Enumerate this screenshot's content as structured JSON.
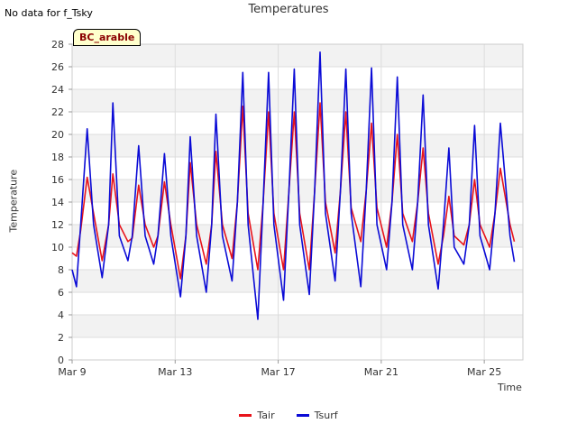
{
  "note": "No data for f_Tsky",
  "badge": "BC_arable",
  "colors": {
    "Tair": "#e8141b",
    "Tsurf": "#0b0bd6",
    "band": "#f2f2f2",
    "grid": "#dddddd"
  },
  "chart_data": {
    "type": "line",
    "title": "Temperatures",
    "xlabel": "Time",
    "ylabel": "Temperature",
    "x_range": [
      "2024-03-09",
      "2024-03-26 12:00"
    ],
    "ylim": [
      0,
      28
    ],
    "yticks": [
      0,
      2,
      4,
      6,
      8,
      10,
      12,
      14,
      16,
      18,
      20,
      22,
      24,
      26,
      28
    ],
    "xticks": [
      {
        "date": "2024-03-09",
        "label": "Mar 9"
      },
      {
        "date": "2024-03-13",
        "label": "Mar 13"
      },
      {
        "date": "2024-03-17",
        "label": "Mar 17"
      },
      {
        "date": "2024-03-21",
        "label": "Mar 21"
      },
      {
        "date": "2024-03-25",
        "label": "Mar 25"
      }
    ],
    "grid": true,
    "legend_position": "bottom-center",
    "series": [
      {
        "name": "Tair",
        "points": [
          [
            "2024-03-09 00:00",
            9.5
          ],
          [
            "2024-03-09 04:00",
            9.2
          ],
          [
            "2024-03-09 08:00",
            11.5
          ],
          [
            "2024-03-09 14:00",
            16.2
          ],
          [
            "2024-03-09 20:00",
            13.0
          ],
          [
            "2024-03-10 04:00",
            8.8
          ],
          [
            "2024-03-10 10:00",
            12.0
          ],
          [
            "2024-03-10 14:00",
            16.5
          ],
          [
            "2024-03-10 20:00",
            12.0
          ],
          [
            "2024-03-11 04:00",
            10.5
          ],
          [
            "2024-03-11 08:00",
            10.8
          ],
          [
            "2024-03-11 14:00",
            15.5
          ],
          [
            "2024-03-11 20:00",
            12.0
          ],
          [
            "2024-03-12 04:00",
            10.0
          ],
          [
            "2024-03-12 08:00",
            11.0
          ],
          [
            "2024-03-12 14:00",
            15.8
          ],
          [
            "2024-03-12 20:00",
            12.0
          ],
          [
            "2024-03-13 05:00",
            7.2
          ],
          [
            "2024-03-13 10:00",
            11.0
          ],
          [
            "2024-03-13 14:00",
            17.5
          ],
          [
            "2024-03-13 20:00",
            12.0
          ],
          [
            "2024-03-14 05:00",
            8.5
          ],
          [
            "2024-03-14 10:00",
            12.0
          ],
          [
            "2024-03-14 14:00",
            18.5
          ],
          [
            "2024-03-14 20:00",
            12.0
          ],
          [
            "2024-03-15 05:00",
            9.0
          ],
          [
            "2024-03-15 10:00",
            14.0
          ],
          [
            "2024-03-15 15:00",
            22.5
          ],
          [
            "2024-03-15 20:00",
            13.0
          ],
          [
            "2024-03-16 05:00",
            8.0
          ],
          [
            "2024-03-16 10:00",
            14.0
          ],
          [
            "2024-03-16 15:00",
            22.0
          ],
          [
            "2024-03-16 20:00",
            13.0
          ],
          [
            "2024-03-17 05:00",
            8.0
          ],
          [
            "2024-03-17 10:00",
            15.0
          ],
          [
            "2024-03-17 15:00",
            22.0
          ],
          [
            "2024-03-17 20:00",
            13.0
          ],
          [
            "2024-03-18 05:00",
            8.0
          ],
          [
            "2024-03-18 10:00",
            15.0
          ],
          [
            "2024-03-18 15:00",
            22.8
          ],
          [
            "2024-03-18 20:00",
            14.0
          ],
          [
            "2024-03-19 05:00",
            9.5
          ],
          [
            "2024-03-19 10:00",
            15.0
          ],
          [
            "2024-03-19 15:00",
            22.0
          ],
          [
            "2024-03-19 20:00",
            13.5
          ],
          [
            "2024-03-20 05:00",
            10.5
          ],
          [
            "2024-03-20 10:00",
            15.0
          ],
          [
            "2024-03-20 15:00",
            21.0
          ],
          [
            "2024-03-20 20:00",
            13.5
          ],
          [
            "2024-03-21 05:00",
            10.0
          ],
          [
            "2024-03-21 10:00",
            14.0
          ],
          [
            "2024-03-21 15:00",
            20.0
          ],
          [
            "2024-03-21 20:00",
            13.0
          ],
          [
            "2024-03-22 05:00",
            10.5
          ],
          [
            "2024-03-22 10:00",
            14.0
          ],
          [
            "2024-03-22 15:00",
            18.8
          ],
          [
            "2024-03-22 20:00",
            13.0
          ],
          [
            "2024-03-23 05:00",
            8.5
          ],
          [
            "2024-03-23 10:00",
            11.0
          ],
          [
            "2024-03-23 15:00",
            14.5
          ],
          [
            "2024-03-23 20:00",
            11.0
          ],
          [
            "2024-03-24 05:00",
            10.2
          ],
          [
            "2024-03-24 10:00",
            12.0
          ],
          [
            "2024-03-24 15:00",
            16.0
          ],
          [
            "2024-03-24 20:00",
            12.0
          ],
          [
            "2024-03-25 05:00",
            10.0
          ],
          [
            "2024-03-25 10:00",
            13.0
          ],
          [
            "2024-03-25 15:00",
            17.0
          ],
          [
            "2024-03-26 00:00",
            12.0
          ],
          [
            "2024-03-26 04:00",
            10.5
          ]
        ]
      },
      {
        "name": "Tsurf",
        "points": [
          [
            "2024-03-09 00:00",
            8.0
          ],
          [
            "2024-03-09 04:00",
            6.5
          ],
          [
            "2024-03-09 08:00",
            12.0
          ],
          [
            "2024-03-09 14:00",
            20.5
          ],
          [
            "2024-03-09 20:00",
            12.0
          ],
          [
            "2024-03-10 04:00",
            7.3
          ],
          [
            "2024-03-10 10:00",
            12.0
          ],
          [
            "2024-03-10 14:00",
            22.8
          ],
          [
            "2024-03-10 20:00",
            11.0
          ],
          [
            "2024-03-11 04:00",
            8.8
          ],
          [
            "2024-03-11 08:00",
            11.0
          ],
          [
            "2024-03-11 14:00",
            19.0
          ],
          [
            "2024-03-11 20:00",
            11.0
          ],
          [
            "2024-03-12 04:00",
            8.5
          ],
          [
            "2024-03-12 08:00",
            11.0
          ],
          [
            "2024-03-12 14:00",
            18.3
          ],
          [
            "2024-03-12 20:00",
            11.0
          ],
          [
            "2024-03-13 05:00",
            5.6
          ],
          [
            "2024-03-13 10:00",
            11.0
          ],
          [
            "2024-03-13 14:00",
            19.8
          ],
          [
            "2024-03-13 20:00",
            11.0
          ],
          [
            "2024-03-14 05:00",
            6.0
          ],
          [
            "2024-03-14 10:00",
            12.0
          ],
          [
            "2024-03-14 14:00",
            21.8
          ],
          [
            "2024-03-14 20:00",
            11.0
          ],
          [
            "2024-03-15 05:00",
            7.0
          ],
          [
            "2024-03-15 10:00",
            14.0
          ],
          [
            "2024-03-15 15:00",
            25.5
          ],
          [
            "2024-03-15 20:00",
            12.0
          ],
          [
            "2024-03-16 05:00",
            3.6
          ],
          [
            "2024-03-16 10:00",
            14.0
          ],
          [
            "2024-03-16 15:00",
            25.5
          ],
          [
            "2024-03-16 20:00",
            12.0
          ],
          [
            "2024-03-17 05:00",
            5.3
          ],
          [
            "2024-03-17 10:00",
            15.0
          ],
          [
            "2024-03-17 15:00",
            25.8
          ],
          [
            "2024-03-17 20:00",
            12.0
          ],
          [
            "2024-03-18 05:00",
            5.8
          ],
          [
            "2024-03-18 10:00",
            15.0
          ],
          [
            "2024-03-18 15:00",
            27.3
          ],
          [
            "2024-03-18 20:00",
            13.0
          ],
          [
            "2024-03-19 05:00",
            7.0
          ],
          [
            "2024-03-19 10:00",
            15.0
          ],
          [
            "2024-03-19 15:00",
            25.8
          ],
          [
            "2024-03-19 20:00",
            13.0
          ],
          [
            "2024-03-20 05:00",
            6.5
          ],
          [
            "2024-03-20 10:00",
            15.0
          ],
          [
            "2024-03-20 15:00",
            25.9
          ],
          [
            "2024-03-20 20:00",
            12.0
          ],
          [
            "2024-03-21 05:00",
            8.0
          ],
          [
            "2024-03-21 10:00",
            14.0
          ],
          [
            "2024-03-21 15:00",
            25.1
          ],
          [
            "2024-03-21 20:00",
            12.0
          ],
          [
            "2024-03-22 05:00",
            8.0
          ],
          [
            "2024-03-22 10:00",
            14.0
          ],
          [
            "2024-03-22 15:00",
            23.5
          ],
          [
            "2024-03-22 20:00",
            12.0
          ],
          [
            "2024-03-23 05:00",
            6.3
          ],
          [
            "2024-03-23 10:00",
            12.0
          ],
          [
            "2024-03-23 15:00",
            18.8
          ],
          [
            "2024-03-23 20:00",
            10.0
          ],
          [
            "2024-03-24 05:00",
            8.5
          ],
          [
            "2024-03-24 10:00",
            12.0
          ],
          [
            "2024-03-24 15:00",
            20.8
          ],
          [
            "2024-03-24 20:00",
            11.0
          ],
          [
            "2024-03-25 05:00",
            8.0
          ],
          [
            "2024-03-25 10:00",
            13.0
          ],
          [
            "2024-03-25 15:00",
            21.0
          ],
          [
            "2024-03-26 00:00",
            11.0
          ],
          [
            "2024-03-26 04:00",
            8.7
          ]
        ]
      }
    ]
  }
}
